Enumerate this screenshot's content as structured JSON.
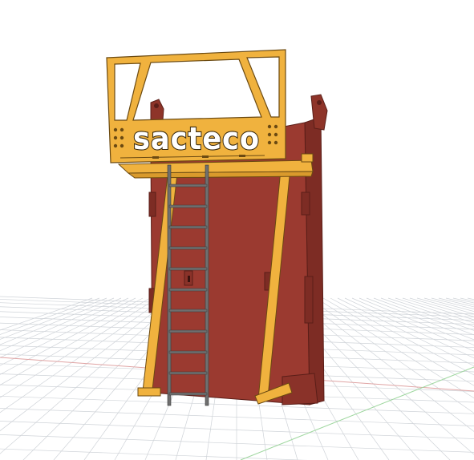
{
  "viewport": {
    "background": "#ffffff",
    "grid_color": "#cfd3d8",
    "axis_x_color": "#e0a4a4",
    "axis_z_color": "#9fd79f"
  },
  "model": {
    "logo_text": "sacteco",
    "colors": {
      "wall": "#9b3a30",
      "wall_shade": "#7d2c24",
      "wall_edge": "#5a1e18",
      "frame": "#f0b23e",
      "frame_edge": "#6b4a12",
      "ladder": "#6f6f6f"
    }
  }
}
